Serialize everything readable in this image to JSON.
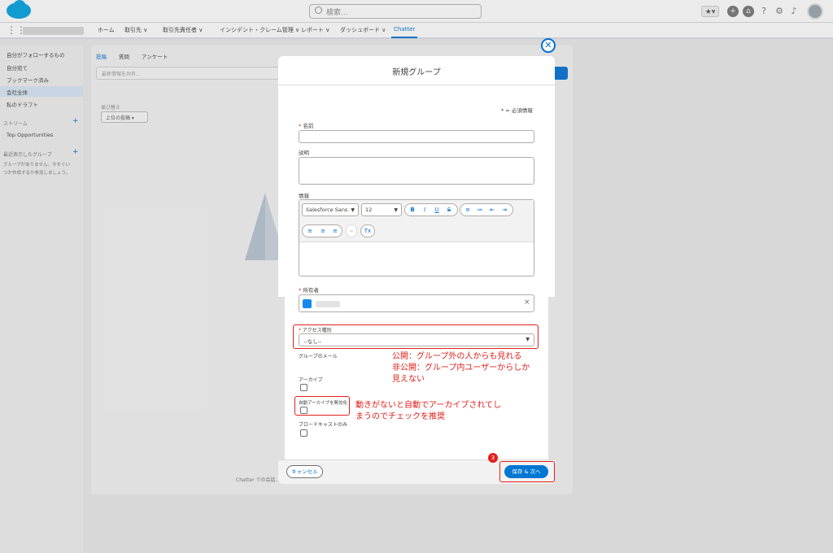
{
  "header": {
    "search_placeholder": "検索...",
    "icons": [
      "favorites-icon",
      "add-icon",
      "help-home-icon",
      "help-icon",
      "setup-icon",
      "notifications-icon",
      "avatar"
    ]
  },
  "nav": {
    "items": [
      {
        "label": "ホーム"
      },
      {
        "label": "取引先 ∨"
      },
      {
        "label": "取引先責任者 ∨"
      },
      {
        "label": "インシデント・クレーム管理 ∨"
      },
      {
        "label": "レポート ∨"
      },
      {
        "label": "ダッシュボード ∨"
      },
      {
        "label": "Chatter"
      }
    ]
  },
  "sidebar": {
    "items": [
      "自分がフォローするもの",
      "自分宛て",
      "ブックマーク済み",
      "会社全体",
      "私のドラフト"
    ],
    "streams_title": "ストリーム",
    "streams_item": "Top Opportunities",
    "groups_title": "最近表示したグループ",
    "groups_note_1": "グループがありません。今すぐい",
    "groups_note_2": "つか作成するか参加しましょう。"
  },
  "feed": {
    "tabs": [
      "投稿",
      "質問",
      "アンケート"
    ],
    "input_placeholder": "最新情報を共有...",
    "sort_label": "並び替え",
    "sort_value": "上位の投稿",
    "empty_text": "Chatter での会話..."
  },
  "modal": {
    "title": "新規グループ",
    "required_note": "* = 必須情報",
    "name_label": "名前",
    "description_label": "説明",
    "info_label": "情報",
    "font_family": "Salesforce Sans",
    "font_size": "12",
    "owner_label": "所有者",
    "access_label": "アクセス種別",
    "access_value": "--なし--",
    "group_email_label": "グループのメール",
    "archive_label": "アーカイブ",
    "auto_archive_label": "自動アーカイブを無効化",
    "broadcast_label": "ブロードキャストのみ",
    "cancel_label": "キャンセル",
    "save_label": "保存 & 次へ"
  },
  "annotations": {
    "access_note_1": "公開：グループ外の人からも見れる",
    "access_note_2": "非公開：グループ内ユーザーからしか",
    "access_note_3": "見えない",
    "archive_note_1": "動きがないと自動でアーカイブされてし",
    "archive_note_2": "まうのでチェックを推奨",
    "step_number": "3"
  },
  "colors": {
    "brand": "#0070d2",
    "annotation": "#e0201b"
  }
}
